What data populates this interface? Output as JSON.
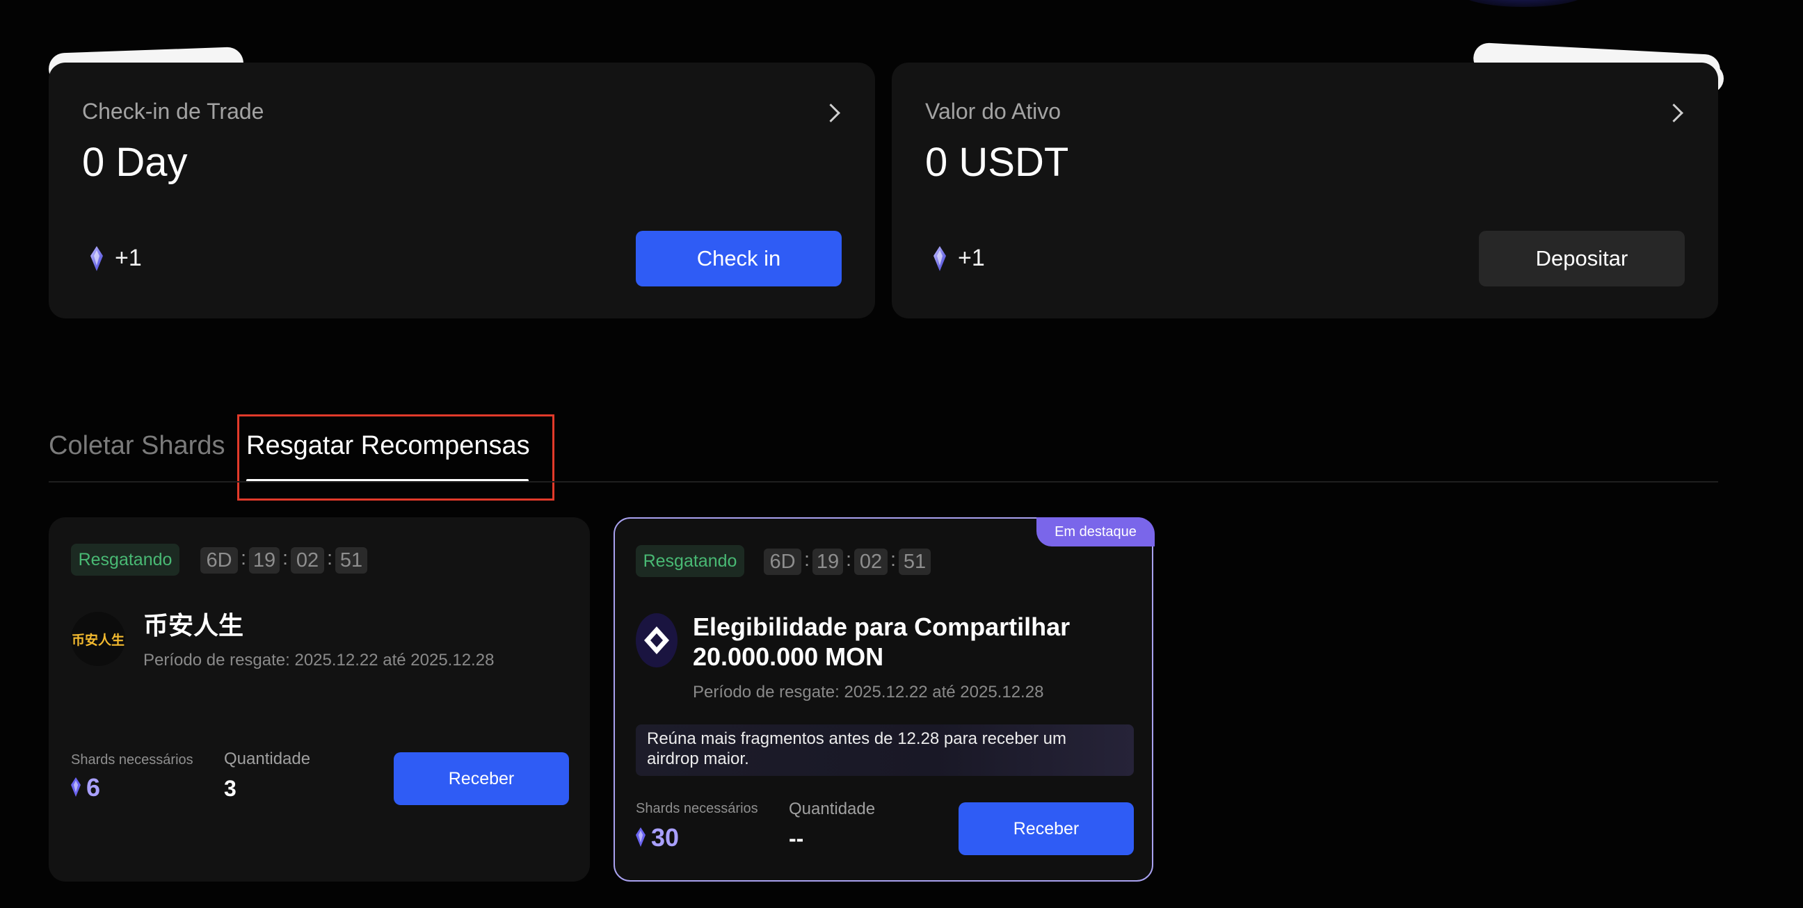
{
  "top_cards": [
    {
      "title": "Check-in de Trade",
      "value": "0 Day",
      "bonus": "+1",
      "button": "Check in"
    },
    {
      "title": "Valor do Ativo",
      "value": "0 USDT",
      "bonus": "+1",
      "button": "Depositar"
    }
  ],
  "tabs": {
    "collect": "Coletar Shards",
    "redeem": "Resgatar Recompensas",
    "active": "redeem"
  },
  "rewards": [
    {
      "status": "Resgatando",
      "countdown": {
        "days": "6D",
        "hours": "19",
        "minutes": "02",
        "seconds": "51"
      },
      "avatar_text": "币安人生",
      "title": "币安人生",
      "period": "Período de resgate: 2025.12.22 até 2025.12.28",
      "shards_label": "Shards necessários",
      "shards_value": "6",
      "qty_label": "Quantidade",
      "qty_value": "3",
      "button": "Receber"
    },
    {
      "featured_tag": "Em destaque",
      "status": "Resgatando",
      "countdown": {
        "days": "6D",
        "hours": "19",
        "minutes": "02",
        "seconds": "51"
      },
      "title_line1": "Elegibilidade para Compartilhar",
      "title_line2": "20.000.000 MON",
      "period": "Período de resgate: 2025.12.22 até 2025.12.28",
      "notice_line1": "Reúna mais fragmentos antes de 12.28 para receber um",
      "notice_line2": "airdrop maior.",
      "shards_label": "Shards necessários",
      "shards_value": "30",
      "qty_label": "Quantidade",
      "qty_value": "--",
      "button": "Receber"
    }
  ],
  "time_separator": ":",
  "colors": {
    "primary_button": "#2f5cf5",
    "status_green": "#49b974",
    "shard_purple": "#a9a0ff",
    "featured_purple": "#7a66ea",
    "highlight_red": "#e23a2a"
  },
  "icons": {
    "chevron": "chevron-right-icon",
    "shard": "shard-gem-icon",
    "mon_logo": "monad-logo-icon"
  }
}
